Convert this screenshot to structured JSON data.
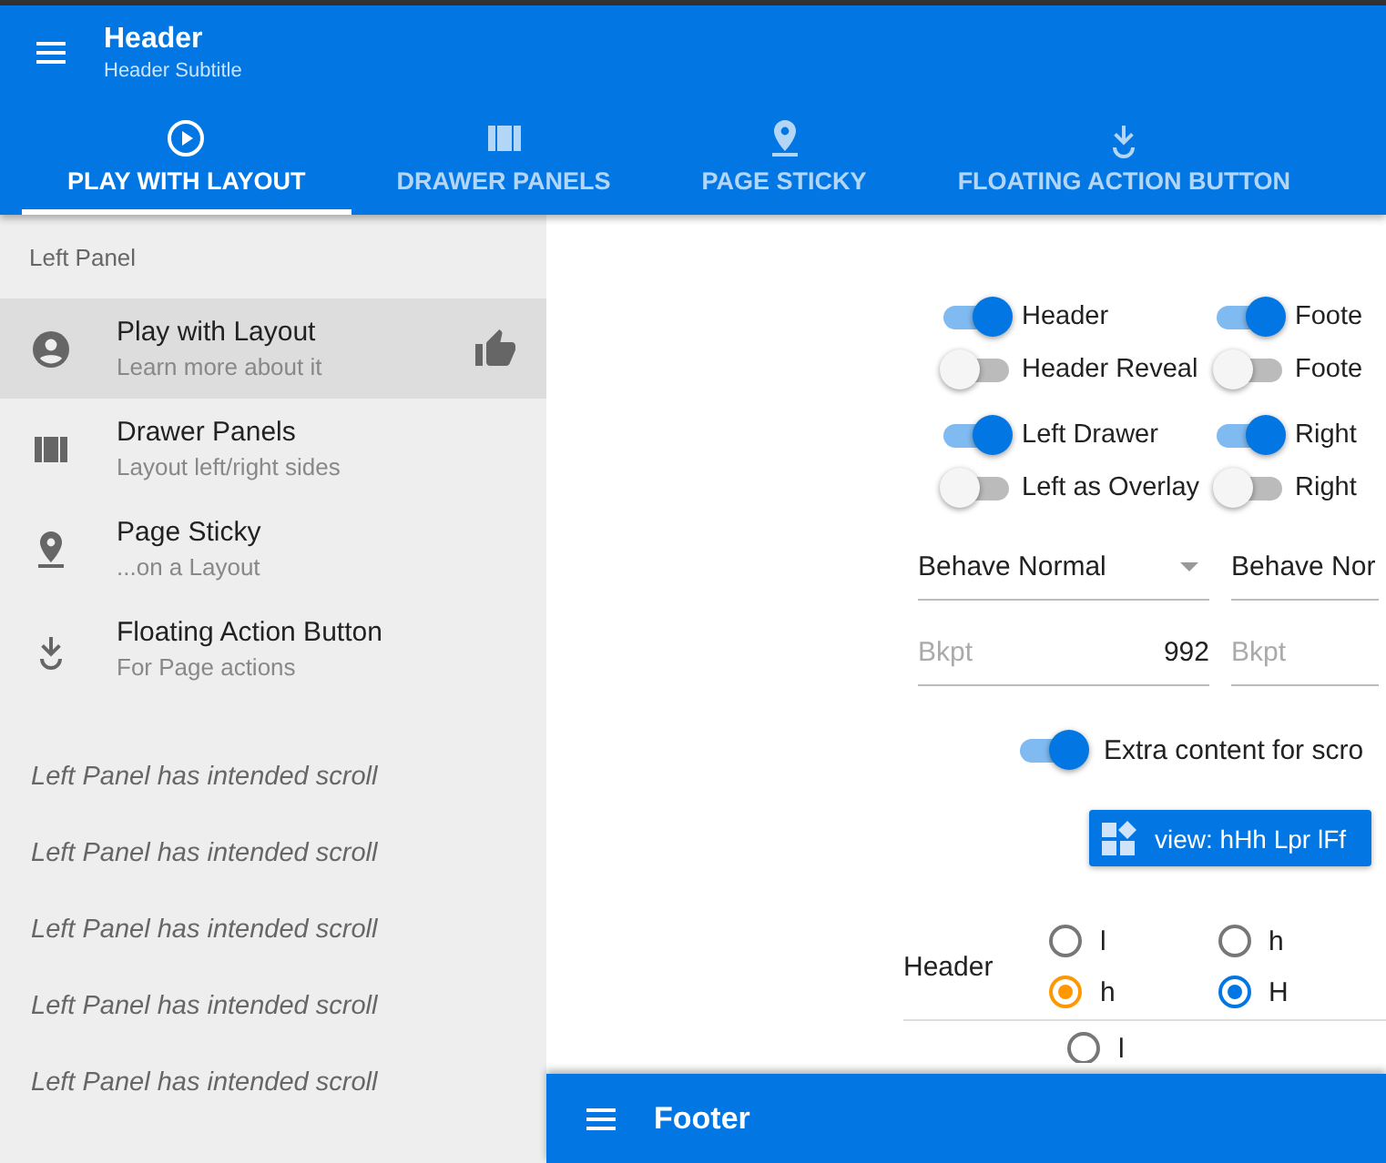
{
  "header": {
    "title": "Header",
    "subtitle": "Header Subtitle"
  },
  "tabs": [
    {
      "label": "PLAY WITH LAYOUT",
      "selected": true
    },
    {
      "label": "DRAWER PANELS",
      "selected": false
    },
    {
      "label": "PAGE STICKY",
      "selected": false
    },
    {
      "label": "FLOATING ACTION BUTTON",
      "selected": false
    }
  ],
  "left_panel": {
    "title": "Left Panel",
    "items": [
      {
        "label": "Play with Layout",
        "sublabel": "Learn more about it",
        "selected": true
      },
      {
        "label": "Drawer Panels",
        "sublabel": "Layout left/right sides",
        "selected": false
      },
      {
        "label": "Page Sticky",
        "sublabel": "...on a Layout",
        "selected": false
      },
      {
        "label": "Floating Action Button",
        "sublabel": "For Page actions",
        "selected": false
      }
    ],
    "notes": [
      "Left Panel has intended scroll",
      "Left Panel has intended scroll",
      "Left Panel has intended scroll",
      "Left Panel has intended scroll",
      "Left Panel has intended scroll"
    ]
  },
  "toggle_groups": [
    [
      {
        "label": "Header",
        "on": true
      },
      {
        "label": "Foote",
        "on": true
      },
      {
        "label": "Header Reveal",
        "on": false
      },
      {
        "label": "Foote",
        "on": false
      }
    ],
    [
      {
        "label": "Left Drawer",
        "on": true
      },
      {
        "label": "Right",
        "on": true
      },
      {
        "label": "Left as Overlay",
        "on": false
      },
      {
        "label": "Right",
        "on": false
      }
    ]
  ],
  "selects": [
    {
      "value": "Behave Normal"
    },
    {
      "value": "Behave Nor"
    }
  ],
  "breakpoints": [
    {
      "placeholder": "Bkpt",
      "value": "992"
    },
    {
      "placeholder": "Bkpt"
    }
  ],
  "extra_toggle": {
    "label": "Extra content for scro",
    "on": true
  },
  "view_button": {
    "label": "view: hHh Lpr lFf"
  },
  "radio_rows": [
    {
      "label": "Header",
      "groups": [
        {
          "color": "#ff9800",
          "options": [
            {
              "label": "l",
              "selected": false
            },
            {
              "label": "h",
              "selected": true
            }
          ]
        },
        {
          "color": "#0277e3",
          "options": [
            {
              "label": "h",
              "selected": false
            },
            {
              "label": "H",
              "selected": true
            }
          ]
        }
      ]
    },
    {
      "groups": [
        {
          "options": [
            {
              "label": "l",
              "selected": false
            }
          ]
        }
      ]
    }
  ],
  "footer": {
    "title": "Footer"
  }
}
